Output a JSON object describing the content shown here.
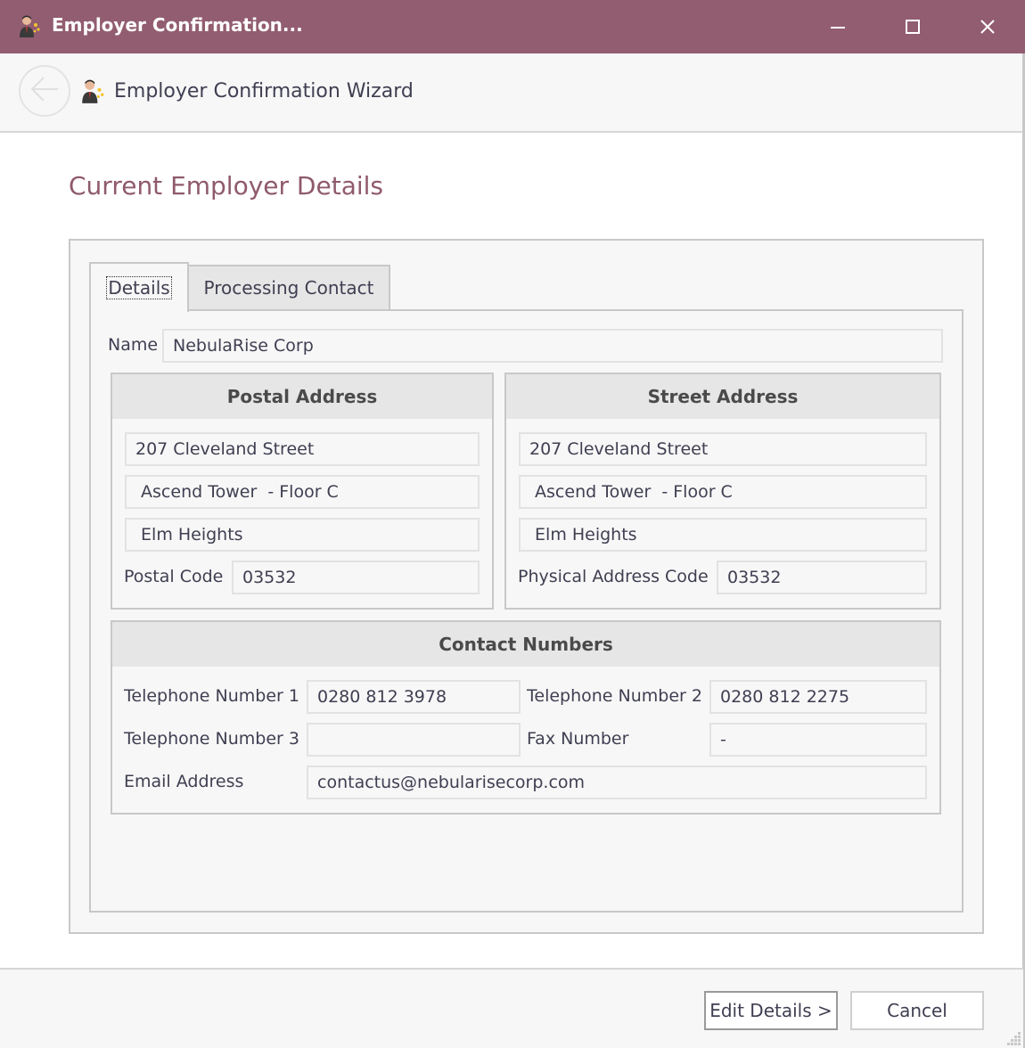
{
  "window": {
    "title": "Employer Confirmation...",
    "app_icon": "employer-person-icon",
    "controls": {
      "minimize": "minimize-icon",
      "maximize": "maximize-icon",
      "close": "close-icon"
    }
  },
  "wizard": {
    "back_icon": "back-arrow-icon",
    "icon": "employer-person-icon",
    "title": "Employer Confirmation Wizard"
  },
  "page": {
    "title": "Current Employer Details"
  },
  "tabs": [
    {
      "label": "Details",
      "active": true
    },
    {
      "label": "Processing Contact",
      "active": false
    }
  ],
  "details": {
    "name_label": "Name",
    "name_value": "NebulaRise Corp",
    "postal": {
      "header": "Postal Address",
      "line1": "207 Cleveland Street",
      "line2": " Ascend Tower  - Floor C",
      "line3": " Elm Heights",
      "code_label": "Postal Code",
      "code_value": "03532"
    },
    "street": {
      "header": "Street Address",
      "line1": "207 Cleveland Street",
      "line2": " Ascend Tower  - Floor C",
      "line3": " Elm Heights",
      "code_label": "Physical Address Code",
      "code_value": "03532"
    },
    "contact": {
      "header": "Contact Numbers",
      "tel1_label": "Telephone Number 1",
      "tel1_value": "0280 812 3978",
      "tel2_label": "Telephone Number 2",
      "tel2_value": "0280 812 2275",
      "tel3_label": "Telephone Number 3",
      "tel3_value": "",
      "fax_label": "Fax Number",
      "fax_value": "-",
      "email_label": "Email Address",
      "email_value": "contactus@nebularisecorp.com"
    }
  },
  "footer": {
    "edit_label": "Edit Details >",
    "cancel_label": "Cancel"
  },
  "colors": {
    "titlebar": "#925d70",
    "page_title": "#8f5a6c",
    "group_header_bg": "#e6e6e6",
    "border": "#c8c8c8"
  }
}
